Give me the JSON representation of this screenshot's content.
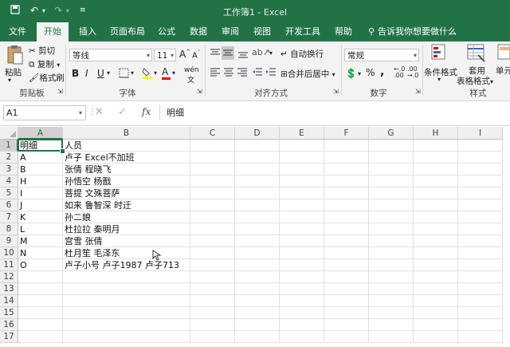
{
  "window": {
    "title": "工作簿1 - Excel",
    "quick_access": {
      "save_icon": "save-icon",
      "undo_icon": "undo-icon",
      "redo_icon": "redo-icon",
      "customize_icon": "customize-icon"
    }
  },
  "tabs": [
    "文件",
    "开始",
    "插入",
    "页面布局",
    "公式",
    "数据",
    "审阅",
    "视图",
    "开发工具",
    "帮助"
  ],
  "active_tab": "开始",
  "tell_me": "告诉我你想要做什么",
  "ribbon": {
    "clipboard": {
      "paste": "粘贴",
      "cut": "剪切",
      "copy": "复制",
      "format_painter": "格式刷",
      "label": "剪贴板"
    },
    "font": {
      "name": "等线",
      "size": "11",
      "bold": "B",
      "italic": "I",
      "underline": "U",
      "grow": "A",
      "shrink": "A",
      "wen": "wén",
      "label": "字体"
    },
    "alignment": {
      "wrap": "自动换行",
      "merge": "合并后居中",
      "label": "对齐方式"
    },
    "number": {
      "format": "常规",
      "percent": "%",
      "comma": ",",
      "label": "数字"
    },
    "styles": {
      "conditional": "条件格式",
      "table_format_1": "套用",
      "table_format_2": "表格格式",
      "cell_style": "单元",
      "label": "样式"
    }
  },
  "formula_bar": {
    "name_box": "A1",
    "fx": "fx",
    "content": "明细"
  },
  "columns": [
    "A",
    "B",
    "C",
    "D",
    "E",
    "F",
    "G",
    "H",
    "I"
  ],
  "rows": [
    "1",
    "2",
    "3",
    "4",
    "5",
    "6",
    "7",
    "8",
    "9",
    "10",
    "11",
    "12",
    "13",
    "14",
    "15",
    "16",
    "17"
  ],
  "cells": [
    [
      "明细",
      "人员"
    ],
    [
      "A",
      "卢子 Excel不加班"
    ],
    [
      "B",
      "张倩 程晓飞"
    ],
    [
      "H",
      "孙悟空 杨戬"
    ],
    [
      "I",
      "菩提 文殊菩萨"
    ],
    [
      "J",
      "如来 鲁智深 时迁"
    ],
    [
      "K",
      "孙二娘"
    ],
    [
      "L",
      "杜拉拉 秦明月"
    ],
    [
      "M",
      "宫雪 张倩"
    ],
    [
      "N",
      "杜月笙 毛泽东"
    ],
    [
      "O",
      "卢子小号 卢子1987 卢子713"
    ]
  ],
  "colors": {
    "brand": "#217346",
    "ribbon_bg": "#f3f3f3",
    "header_bg": "#f0f0f0"
  }
}
